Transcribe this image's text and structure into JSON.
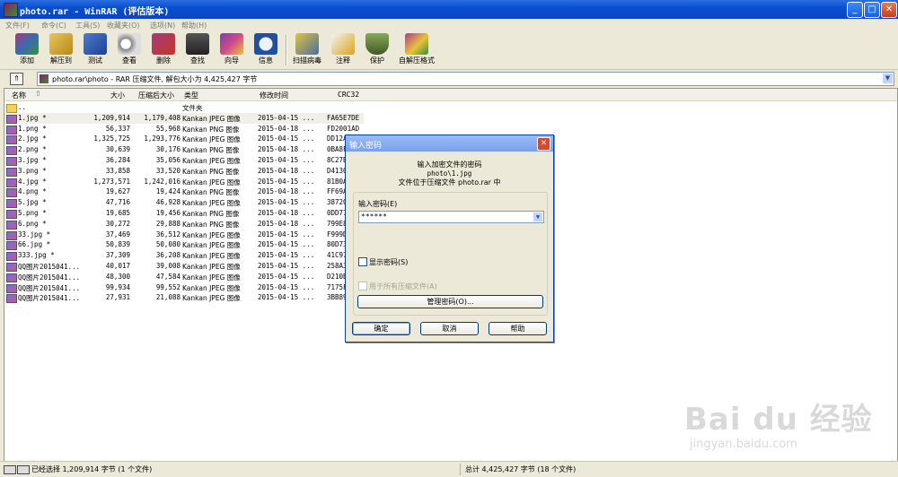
{
  "window": {
    "title": "photo.rar - WinRAR (评估版本)",
    "minimize_glyph": "_",
    "maximize_glyph": "□",
    "close_glyph": "✕"
  },
  "menu": [
    "文件(F)",
    "命令(C)",
    "工具(S)",
    "收藏夹(O)",
    "选项(N)",
    "帮助(H)"
  ],
  "toolbar": [
    {
      "label": "添加",
      "icon": "add-archive-icon",
      "color": "#a83a7a"
    },
    {
      "label": "解压到",
      "icon": "extract-to-icon",
      "color": "#d6a21e"
    },
    {
      "label": "测试",
      "icon": "test-icon",
      "color": "#2c5bb0"
    },
    {
      "label": "查看",
      "icon": "view-icon",
      "color": "#777777"
    },
    {
      "label": "删除",
      "icon": "delete-icon",
      "color": "#c0392b"
    },
    {
      "label": "查找",
      "icon": "find-icon",
      "color": "#444444"
    },
    {
      "label": "向导",
      "icon": "wizard-icon",
      "color": "#7b3fa6"
    },
    {
      "label": "信息",
      "icon": "info-icon",
      "color": "#1f4fa0"
    },
    {
      "label": "扫描病毒",
      "icon": "virus-scan-icon",
      "color": "#4a6f9a"
    },
    {
      "label": "注释",
      "icon": "comment-icon",
      "color": "#d9a520"
    },
    {
      "label": "保护",
      "icon": "protect-icon",
      "color": "#5a7a3a"
    },
    {
      "label": "自解压格式",
      "icon": "sfx-icon",
      "color": "#b03a8a"
    }
  ],
  "address": {
    "up_glyph": "⇑",
    "text": "photo.rar\\photo - RAR 压缩文件, 解包大小为 4,425,427 字节",
    "dropdown_glyph": "▼"
  },
  "columns": {
    "name": "名称",
    "sort_glyph": "⇧",
    "size": "大小",
    "packed": "压缩后大小",
    "type": "类型",
    "modified": "修改时间",
    "crc": "CRC32"
  },
  "files": [
    {
      "name": "..",
      "size": "",
      "packed": "",
      "type": "文件夹",
      "modified": "",
      "crc": "",
      "folder": true
    },
    {
      "name": "1.jpg *",
      "size": "1,209,914",
      "packed": "1,179,408",
      "type": "Kankan JPEG 图像",
      "modified": "2015-04-15 ...",
      "crc": "FA65E7DE",
      "selected": true
    },
    {
      "name": "1.png *",
      "size": "56,337",
      "packed": "55,968",
      "type": "Kankan PNG 图像",
      "modified": "2015-04-18 ...",
      "crc": "FD2001AD"
    },
    {
      "name": "2.jpg *",
      "size": "1,325,725",
      "packed": "1,293,776",
      "type": "Kankan JPEG 图像",
      "modified": "2015-04-15 ...",
      "crc": "DD12A"
    },
    {
      "name": "2.png *",
      "size": "30,639",
      "packed": "30,176",
      "type": "Kankan PNG 图像",
      "modified": "2015-04-18 ...",
      "crc": "0BA8F"
    },
    {
      "name": "3.jpg *",
      "size": "36,284",
      "packed": "35,056",
      "type": "Kankan JPEG 图像",
      "modified": "2015-04-15 ...",
      "crc": "8C27B"
    },
    {
      "name": "3.png *",
      "size": "33,858",
      "packed": "33,520",
      "type": "Kankan PNG 图像",
      "modified": "2015-04-18 ...",
      "crc": "D4130"
    },
    {
      "name": "4.jpg *",
      "size": "1,273,571",
      "packed": "1,242,016",
      "type": "Kankan JPEG 图像",
      "modified": "2015-04-15 ...",
      "crc": "81B0A"
    },
    {
      "name": "4.png *",
      "size": "19,627",
      "packed": "19,424",
      "type": "Kankan PNG 图像",
      "modified": "2015-04-18 ...",
      "crc": "FF69A"
    },
    {
      "name": "5.jpg *",
      "size": "47,716",
      "packed": "46,928",
      "type": "Kankan JPEG 图像",
      "modified": "2015-04-15 ...",
      "crc": "38720"
    },
    {
      "name": "5.png *",
      "size": "19,685",
      "packed": "19,456",
      "type": "Kankan PNG 图像",
      "modified": "2015-04-18 ...",
      "crc": "0DD77"
    },
    {
      "name": "6.png *",
      "size": "30,272",
      "packed": "29,888",
      "type": "Kankan PNG 图像",
      "modified": "2015-04-18 ...",
      "crc": "799E8"
    },
    {
      "name": "33.jpg *",
      "size": "37,469",
      "packed": "36,512",
      "type": "Kankan JPEG 图像",
      "modified": "2015-04-15 ...",
      "crc": "F999D"
    },
    {
      "name": "66.jpg *",
      "size": "50,839",
      "packed": "50,080",
      "type": "Kankan JPEG 图像",
      "modified": "2015-04-15 ...",
      "crc": "80D73"
    },
    {
      "name": "333.jpg *",
      "size": "37,309",
      "packed": "36,208",
      "type": "Kankan JPEG 图像",
      "modified": "2015-04-15 ...",
      "crc": "41C97"
    },
    {
      "name": "QQ图片2015041...",
      "size": "40,017",
      "packed": "39,008",
      "type": "Kankan JPEG 图像",
      "modified": "2015-04-15 ...",
      "crc": "258A3"
    },
    {
      "name": "QQ图片2015041...",
      "size": "48,300",
      "packed": "47,584",
      "type": "Kankan JPEG 图像",
      "modified": "2015-04-15 ...",
      "crc": "D210B"
    },
    {
      "name": "QQ图片2015041...",
      "size": "99,934",
      "packed": "99,552",
      "type": "Kankan JPEG 图像",
      "modified": "2015-04-15 ...",
      "crc": "7175F"
    },
    {
      "name": "QQ图片2015041...",
      "size": "27,931",
      "packed": "21,088",
      "type": "Kankan JPEG 图像",
      "modified": "2015-04-15 ...",
      "crc": "3BB89"
    }
  ],
  "status": {
    "selected": "已经选择 1,209,914 字节 (1 个文件)",
    "total": "总计 4,425,427 字节 (18 个文件)"
  },
  "dialog": {
    "title": "输入密码",
    "close_glyph": "✕",
    "line1": "输入加密文件的密码",
    "line2": "photo\\1.jpg",
    "line3": "文件位于压缩文件 photo.rar 中",
    "password_label": "输入密码(E)",
    "password_value": "******",
    "dropdown_glyph": "▼",
    "show_password": "显示密码(S)",
    "use_for_all": "用于所有压缩文件(A)",
    "manage_button": "管理密码(O)...",
    "ok_button": "确定",
    "cancel_button": "取消",
    "help_button": "帮助"
  },
  "watermark": {
    "brand": "Bai du 经验",
    "url": "jingyan.baidu.com"
  }
}
